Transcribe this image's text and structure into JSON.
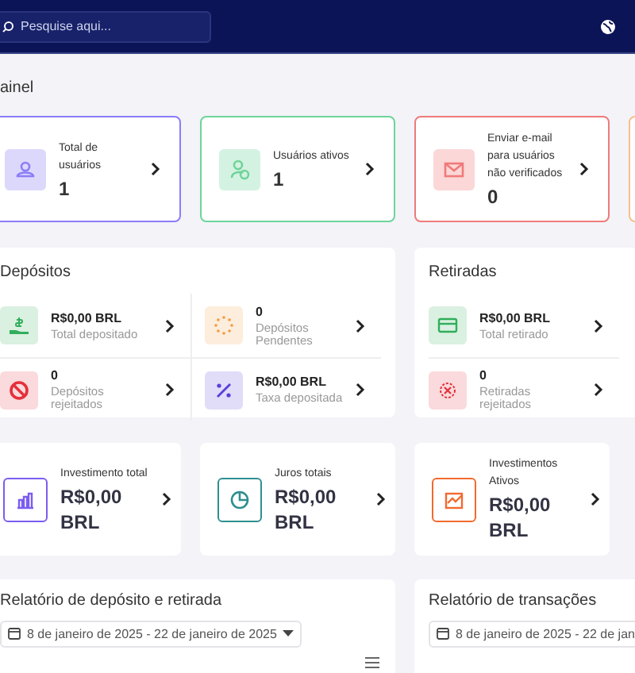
{
  "header": {
    "search": {
      "placeholder": "Pesquise aqui..."
    }
  },
  "page_title": "ainel",
  "summary_cards": [
    {
      "label": "Total de usuários",
      "value": "1",
      "color": "#8b7cf6"
    },
    {
      "label": "Usuários ativos",
      "value": "1",
      "color": "#6fd49a"
    },
    {
      "label": "Enviar e-mail para usuários não verificados",
      "value": "0",
      "color": "#f07a7a"
    },
    {
      "color": "#f7c08a"
    }
  ],
  "stat_panels": [
    {
      "title": "Depósitos",
      "items": [
        {
          "value": "R$0,00 BRL",
          "label": "Total depositado",
          "color": "#2fae5b"
        },
        {
          "value": "0",
          "label": "Depósitos Pendentes",
          "color": "#f39a3c"
        },
        {
          "value": "0",
          "label": "Depósitos rejeitados",
          "color": "#e5303a"
        },
        {
          "value": "R$0,00 BRL",
          "label": "Taxa depositada",
          "color": "#5b3fd9"
        }
      ]
    },
    {
      "title": "Retiradas",
      "items": [
        {
          "value": "R$0,00 BRL",
          "label": "Total retirado",
          "color": "#2fae5b"
        },
        {
          "value": "0",
          "label": "Retiradas rejeitados",
          "color": "#e5303a"
        }
      ]
    }
  ],
  "investment_cards": [
    {
      "label": "Investimento total",
      "value": "R$0,00 BRL",
      "color": "#7b5cf0"
    },
    {
      "label": "Juros totais",
      "value": "R$0,00 BRL",
      "color": "#2f8f8f"
    },
    {
      "label": "Investimentos Ativos",
      "value": "R$0,00 BRL",
      "color": "#f26a2e"
    }
  ],
  "reports": [
    {
      "title": "Relatório de depósito e retirada",
      "date_range": "8 de janeiro de 2025 - 22 de janeiro de 2025"
    },
    {
      "title": "Relatório de transações",
      "date_range": "8 de janeiro de 2025 - 22 de jan"
    }
  ]
}
